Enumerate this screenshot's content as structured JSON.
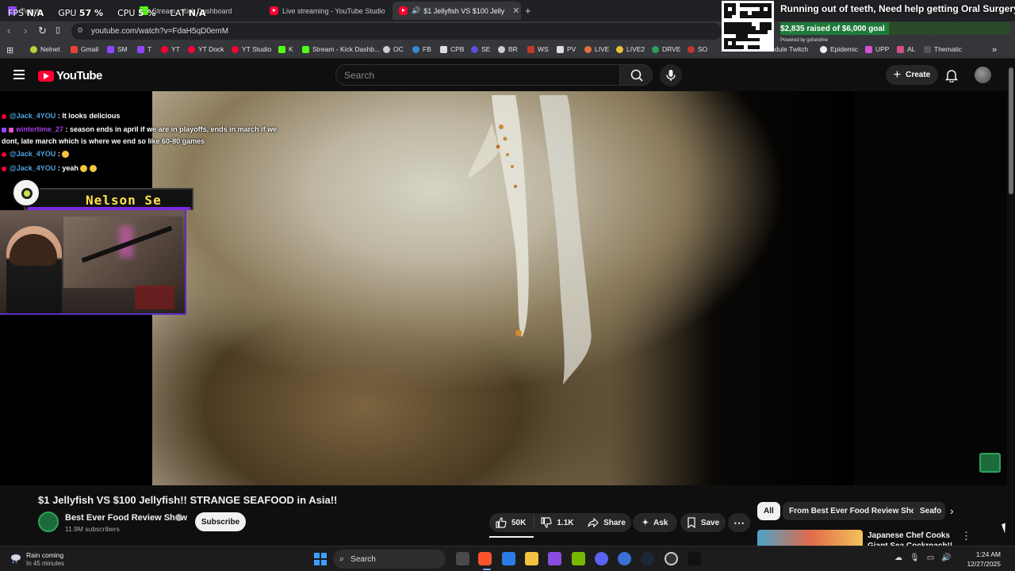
{
  "overlay_stats": {
    "fps_label": "FPS",
    "fps_value": "N/A",
    "gpu_label": "GPU",
    "gpu_value": "57 %",
    "cpu_label": "CPU",
    "cpu_value": "5 %",
    "lat_label": "LAT",
    "lat_value": "N/A"
  },
  "browser": {
    "tabs": [
      {
        "title": "Twitch",
        "favicon": "twitch-icon"
      },
      {
        "title": "Stream - Kick Dashboard",
        "favicon": "kick-icon"
      },
      {
        "title": "Live streaming - YouTube Studio",
        "favicon": "youtube-icon"
      },
      {
        "title": "$1 Jellyfish VS $100 Jellyfish!!",
        "favicon": "youtube-icon",
        "active": true
      }
    ],
    "new_tab": "+",
    "close_glyph": "✕",
    "url": "youtube.com/watch?v=FdaH5qD0emM",
    "bookmarks": [
      "Nelnet",
      "Gmail",
      "SM",
      "T",
      "YT",
      "YT Dock",
      "YT Studio",
      "K",
      "Stream - Kick Dashb...",
      "OC",
      "FB",
      "CPB",
      "SE",
      "BR",
      "WS",
      "PV",
      "LIVE",
      "LIVE2",
      "DRVE",
      "SO",
      "edule Twitch",
      "Epidemic",
      "UPP",
      "AL",
      "Thematic"
    ],
    "bookmarks_overflow": "»"
  },
  "donation": {
    "title": "Running out of teeth, Need help getting Oral Surgery!",
    "raised_text": "$2,835 raised of $6,000 goal",
    "progress_fraction": 0.4725,
    "powered_by": "Powered by gofundme"
  },
  "youtube": {
    "logo_text": "YouTube",
    "search_placeholder": "Search",
    "create_label": "Create",
    "create_plus": "+",
    "video": {
      "title": "$1 Jellyfish VS $100 Jellyfish!! STRANGE SEAFOOD in Asia!!",
      "channel_name": "Best Ever Food Review Show",
      "subscribers": "11.9M subscribers",
      "subscribe_label": "Subscribe",
      "likes": "50K",
      "dislikes": "1.1K",
      "share_label": "Share",
      "ask_label": "Ask",
      "save_label": "Save",
      "more_label": "⋯"
    },
    "chips": [
      "All",
      "From Best Ever Food Review Show",
      "Seafo"
    ],
    "chips_next": "›",
    "recommendation": {
      "title": "Japanese Chef Cooks Giant Sea Cockroach!!",
      "more": "⋮"
    }
  },
  "chat": [
    {
      "user": "@Jack_4YOU",
      "sep": " : ",
      "message": "It looks delicious",
      "platform": "youtube"
    },
    {
      "user": "wintertime_27",
      "sep": " : ",
      "message": "season ends in april if we are in playoffs, ends in march if we",
      "message2": "dont, late march which is where we end so like 60-80 games",
      "platform": "twitch"
    },
    {
      "user": "@Jack_4YOU",
      "sep": " : ",
      "message": "",
      "platform": "youtube"
    },
    {
      "user": "@Jack_4YOU",
      "sep": " : ",
      "message": "yeah",
      "platform": "youtube"
    }
  ],
  "streamer": {
    "nameplate": "Nelson Se"
  },
  "taskbar": {
    "weather_line1": "Rain coming",
    "weather_line2": "In 45 minutes",
    "search_label": "Search",
    "time": "1:24 AM",
    "date": "12/27/2025"
  },
  "colors": {
    "accent_red": "#ff0033",
    "twitch_purple": "#9146ff",
    "kick_green": "#53fc18",
    "gofundme_green": "#1f7a3a"
  }
}
